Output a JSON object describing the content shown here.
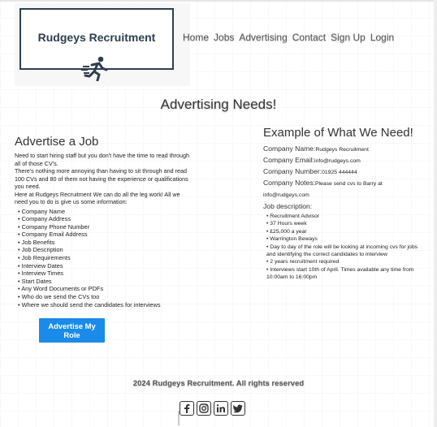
{
  "brand": {
    "name": "Rudgeys Recruitment"
  },
  "nav": [
    "Home",
    "Jobs",
    "Advertising",
    "Contact",
    "Sign Up",
    "Login"
  ],
  "page": {
    "title": "Advertising Needs!"
  },
  "advertise": {
    "heading": "Advertise a Job",
    "para1": "Need to start hiring staff but you don't have the time to read through all of those CV's.",
    "para2": "There's nothing more annoying than having to sit through and read 100 CVs and 80 of them not having the experience or qualifications you need.",
    "para3": "Here at Rudgeys Recruitment We can do all the leg work! All we need you to do is give us some information:",
    "items": [
      "Company Name",
      "Company Address",
      "Company Phone Number",
      "Company Email Address",
      "Job Benefits",
      "Job Description",
      "Job Requirements",
      "Interview Dates",
      "Interview Times",
      "Start Dates",
      "Any Word Documents or PDFs",
      "Who do we send the CVs too",
      "Where we should send the candidates for interviews"
    ],
    "button_line1": "Advertise My",
    "button_line2": "Role"
  },
  "example": {
    "heading": "Example of What We Need!",
    "company_name_label": "Company Name:",
    "company_name_value": "Rudgeys Recruitment",
    "company_email_label": "Company Email:",
    "company_email_value": "info@rudgeys.com",
    "company_number_label": "Company Number:",
    "company_number_value": "01925 444444",
    "company_notes_label": "Company Notes:",
    "company_notes_value": "Please send cvs to Barry at info@rudgeys.com",
    "job_desc_label": "Job description:",
    "job_items": [
      "Recruitment Advisor",
      "37 Hours week",
      "£25,000 a year",
      "Warrington Beways",
      "Day to day of the role will be looking at incoming cvs for jobs and identifying the correct candidates to interview",
      "2 years recruitment required",
      "Interviews start 10th of April. Times available any time from 10:00am to 16:00pm"
    ]
  },
  "footer": {
    "text": "2024 Rudgeys Recruitment. All rights reserved"
  },
  "socials": [
    "facebook-icon",
    "instagram-icon",
    "linkedin-icon",
    "twitter-icon"
  ],
  "colors": {
    "accent": "#1a8be8",
    "logo": "#2e3f51"
  }
}
